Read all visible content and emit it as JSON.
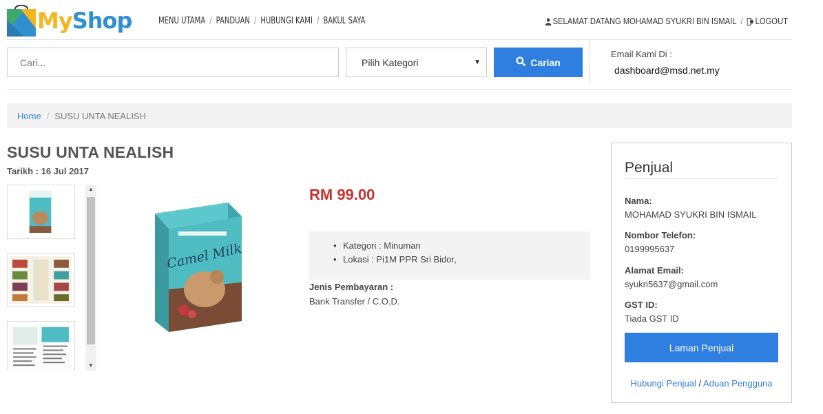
{
  "brand": {
    "part1": "My",
    "part2": "Shop"
  },
  "nav": {
    "items": [
      "MENU UTAMA",
      "PANDUAN",
      "HUBUNGI KAMI",
      "BAKUL SAYA"
    ],
    "separator": "/"
  },
  "user": {
    "greeting": "SELAMAT DATANG MOHAMAD SYUKRI BIN ISMAIL",
    "logout": "LOGOUT",
    "separator": "/"
  },
  "search": {
    "placeholder": "Cari...",
    "category": "Pilih Kategori",
    "button": "Carian"
  },
  "contact": {
    "label": "Email Kami Di :",
    "email": "dashboard@msd.net.my"
  },
  "breadcrumb": {
    "home": "Home",
    "separator": "/",
    "current": "SUSU UNTA NEALISH"
  },
  "product": {
    "title": "SUSU UNTA NEALISH",
    "date": "Tarikh : 16 Jul 2017",
    "price": "RM 99.00",
    "details": [
      "Kategori : Minuman",
      "Lokasi : Pi1M PPR Sri Bidor,"
    ],
    "payment_label": "Jenis Pembayaran :",
    "payment_value": "Bank Transfer / C.O.D.",
    "image_text": "Camel Milk"
  },
  "seller": {
    "title": "Penjual",
    "name_label": "Nama:",
    "name": "MOHAMAD SYUKRI BIN ISMAIL",
    "phone_label": "Nombor Telefon:",
    "phone": "0199995637",
    "email_label": "Alamat Email:",
    "email": "syukri5637@gmail.com",
    "gst_label": "GST ID:",
    "gst": "Tiada GST ID",
    "button": "Laman Penjual",
    "link_contact": "Hubungi Penjual",
    "link_sep": "/",
    "link_report": "Aduan Pengguna"
  },
  "colors": {
    "primary": "#2f7fe0",
    "price": "#c9302c",
    "link": "#2f7fd0",
    "logo_yellow": "#f2b61f",
    "logo_blue": "#2f8fcf"
  },
  "icons": [
    "user-icon",
    "logout-icon",
    "search-icon",
    "dropdown-caret-icon"
  ]
}
